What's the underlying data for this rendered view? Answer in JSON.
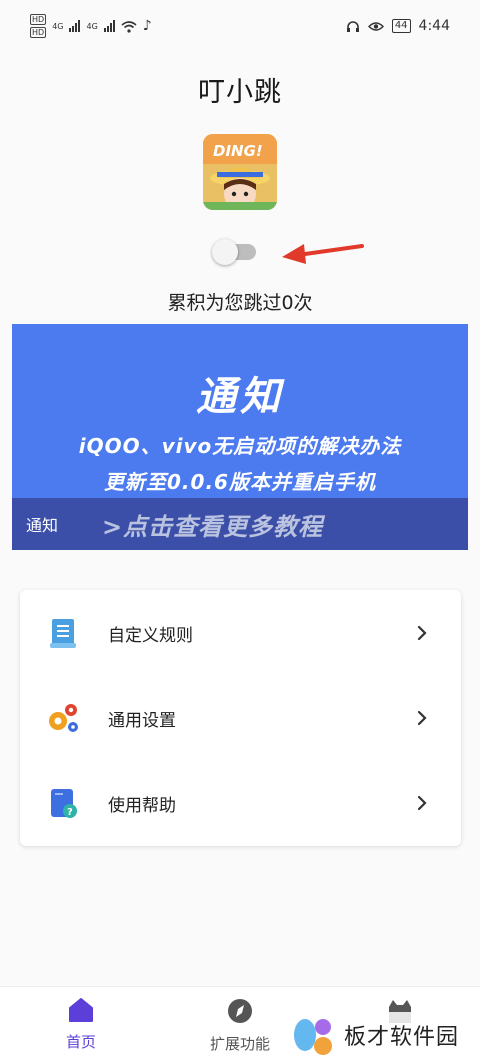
{
  "status_bar": {
    "time": "4:44",
    "battery": "44",
    "network_1": "4G",
    "network_2": "4G",
    "hd_1": "HD",
    "hd_2": "HD"
  },
  "app": {
    "title": "叮小跳",
    "logo_text": "DING!",
    "toggle_on": false,
    "skip_count_text": "累积为您跳过0次"
  },
  "notice": {
    "title": "通知",
    "line1": "iQOO、vivo无启动项的解决办法",
    "line2": "更新至0.0.6版本并重启手机",
    "label": "通知",
    "more": ">点击查看更多教程",
    "bg_color": "#4c7bef",
    "footer_color": "#3c4fa8"
  },
  "menu": {
    "items": [
      {
        "label": "自定义规则",
        "icon": "document-list-icon"
      },
      {
        "label": "通用设置",
        "icon": "gears-icon"
      },
      {
        "label": "使用帮助",
        "icon": "help-book-icon"
      }
    ]
  },
  "bottom_nav": {
    "items": [
      {
        "label": "首页",
        "icon": "home-icon",
        "active": true
      },
      {
        "label": "扩展功能",
        "icon": "compass-icon",
        "active": false
      },
      {
        "label": "",
        "icon": "cat-icon",
        "active": false
      }
    ],
    "accent": "#5b3fd8"
  },
  "watermark": {
    "text": "板才软件园"
  }
}
